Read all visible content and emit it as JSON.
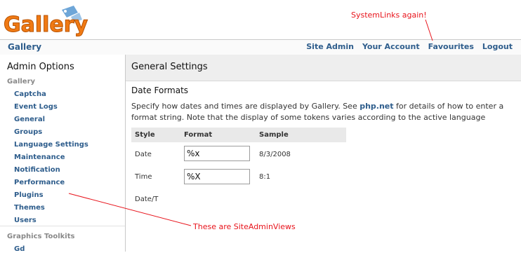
{
  "logo": {
    "text": "Gallery",
    "colors": {
      "orange": "#f07a14",
      "blue": "#6ea6d8"
    }
  },
  "annotations": {
    "top": "SystemLinks again!",
    "bottom": "These are SiteAdminViews",
    "color": "#e8131b"
  },
  "nav": {
    "home": "Gallery",
    "links": [
      "Site Admin",
      "Your Account",
      "Favourites",
      "Logout"
    ]
  },
  "sidebar": {
    "title": "Admin Options",
    "groups": [
      {
        "label": "Gallery",
        "items": [
          "Captcha",
          "Event Logs",
          "General",
          "Groups",
          "Language Settings",
          "Maintenance",
          "Notification",
          "Performance",
          "Plugins",
          "Themes",
          "Users"
        ]
      },
      {
        "label": "Graphics Toolkits",
        "items": [
          "Gd"
        ]
      }
    ]
  },
  "main": {
    "heading": "General Settings",
    "section": "Date Formats",
    "description_pre": "Specify how dates and times are displayed by Gallery. See ",
    "description_link": "php.net",
    "description_post": " for details of how to enter a format string. Note that the display of some tokens varies according to the active language",
    "table": {
      "headers": [
        "Style",
        "Format",
        "Sample"
      ],
      "rows": [
        {
          "style": "Date",
          "format": "%x",
          "sample": "8/3/2008"
        },
        {
          "style": "Time",
          "format": "%X",
          "sample": "8:1"
        },
        {
          "style": "Date/T",
          "format": "",
          "sample": ""
        }
      ]
    }
  },
  "colors": {
    "link": "#2e5d8c",
    "border": "#c9c9c9",
    "header_bg": "#eeeeee"
  }
}
